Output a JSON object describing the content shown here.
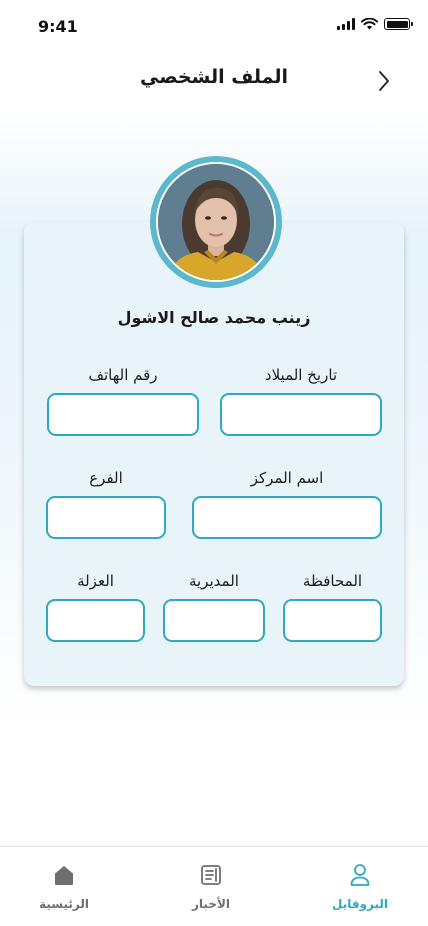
{
  "status_bar": {
    "time": "9:41"
  },
  "header": {
    "title": "الملف الشخصي"
  },
  "profile": {
    "name": "زينب محمد صالح الاشول"
  },
  "fields": {
    "birth_date": {
      "label": "تاريخ الميلاد",
      "value": ""
    },
    "phone": {
      "label": "رقم الهاتف",
      "value": ""
    },
    "center_name": {
      "label": "اسم المركز",
      "value": ""
    },
    "branch": {
      "label": "الفرع",
      "value": ""
    },
    "governorate": {
      "label": "المحافظة",
      "value": ""
    },
    "directorate": {
      "label": "المديرية",
      "value": ""
    },
    "uzla": {
      "label": "العزلة",
      "value": ""
    }
  },
  "bottom_nav": {
    "items": [
      {
        "label": "البروفايل",
        "icon": "user-icon",
        "active": true
      },
      {
        "label": "الأخبار",
        "icon": "news-icon",
        "active": false
      },
      {
        "label": "الرئيسية",
        "icon": "home-icon",
        "active": false
      }
    ]
  },
  "colors": {
    "accent": "#2fa9c2",
    "avatar_ring": "#5bb8cd",
    "card_bg": "#e9f4f9",
    "nav_inactive": "#6f6f6f"
  }
}
